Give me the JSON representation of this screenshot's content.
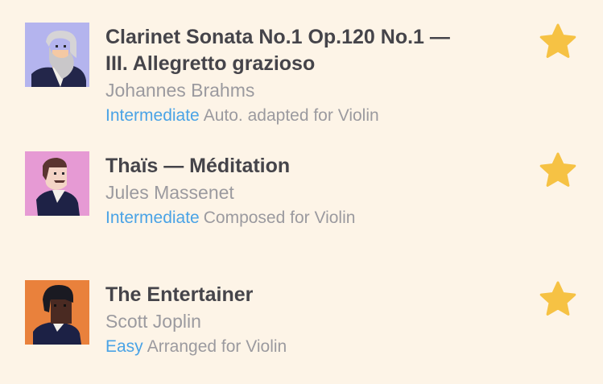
{
  "pieces": [
    {
      "title_line1": "Clarinet Sonata No.1 Op.120 No.1 —",
      "title_line2": "III. Allegretto grazioso",
      "composer": "Johannes Brahms",
      "level": "Intermediate",
      "note": "Auto. adapted for Violin",
      "favorite": true,
      "avatar_icon": "brahms-portrait-icon"
    },
    {
      "title_line1": "Thaïs — Méditation",
      "composer": "Jules Massenet",
      "level": "Intermediate",
      "note": "Composed for Violin",
      "favorite": true,
      "avatar_icon": "massenet-portrait-icon"
    },
    {
      "title_line1": "The Entertainer",
      "composer": "Scott Joplin",
      "level": "Easy",
      "note": "Arranged for Violin",
      "favorite": true,
      "avatar_icon": "joplin-portrait-icon"
    }
  ],
  "colors": {
    "background": "#fdf4e7",
    "title": "#45444a",
    "secondary_text": "#9b9a9f",
    "level_link": "#4aa3e6",
    "star": "#f6c244"
  }
}
